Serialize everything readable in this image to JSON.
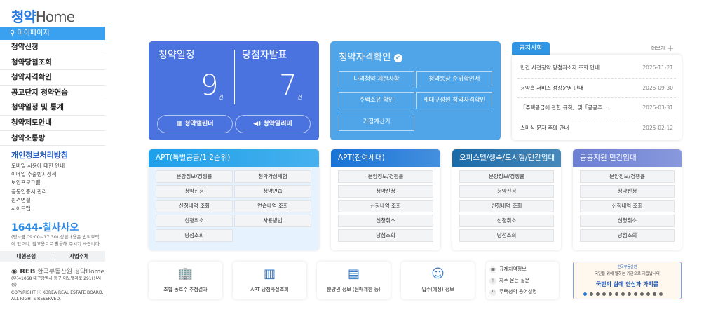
{
  "sidebar": {
    "logo_kr": "청약",
    "logo_en": "Home",
    "mypage": "마이페이지",
    "menu": [
      "청약신청",
      "청약당첨조회",
      "청약자격확인",
      "공고단지 청약연습",
      "청약일정 및 통계",
      "청약제도안내",
      "청약소통방"
    ],
    "policy": "개인정보처리방침",
    "links": [
      "모바일 사용에 대한 안내",
      "이메일 추출방지정책",
      "보안프로그램",
      "공동인증서 관리",
      "원격연결",
      "사이트맵"
    ],
    "phone": "1644-칠사사오",
    "phone_note": "(평~금 09:00~17:30) 상담내용은 법적효력이 없으니, 참고용으로 활용해 주시기 바랍니다.",
    "bank": "대행은행",
    "biz": "사업주체",
    "org": "한국부동산원",
    "org_logo": "REB",
    "org_app": "청약Home",
    "address": "(우)41068 대구광역시 동구 이노밸리로 291(신서동)",
    "copyright": "COPYRIGHT ⓒ KOREA REAL ESTATE BOARD, ALL RIGHTS RESERVED."
  },
  "schedule": {
    "title1": "청약일정",
    "count1": "9",
    "unit1": "건",
    "title2": "당첨자발표",
    "count2": "7",
    "unit2": "건",
    "btn1": "청약캘린더",
    "btn2": "청약알리미"
  },
  "eligibility": {
    "title": "청약자격확인",
    "buttons": [
      "나의청약 제한사항",
      "청약통장 순위확인서",
      "주택소유 확인",
      "세대구성원 청약자격확인",
      "가점계산기"
    ]
  },
  "notice": {
    "tab": "공지사항",
    "more": "더보기",
    "items": [
      {
        "title": "민간 사전청약 당첨취소자 조회 안내",
        "date": "2025-11-21"
      },
      {
        "title": "청약홈 서비스 정상운영 안내",
        "date": "2025-09-30"
      },
      {
        "title": "「주택공급에 관한 규칙」및「공공주…",
        "date": "2025-03-31"
      },
      {
        "title": "스미싱 문자 주의 안내",
        "date": "2025-02-12"
      }
    ]
  },
  "panels": [
    {
      "title": "APT(특별공급/1·2순위)",
      "color": "#1ea0ea",
      "buttons": [
        "분양정보/경쟁률",
        "청약가상체험",
        "청약신청",
        "청약연습",
        "신청내역 조회",
        "연습내역 조회",
        "신청취소",
        "사용방법",
        "당첨조회"
      ]
    },
    {
      "title": "APT(잔여세대)",
      "color": "#1673d6",
      "buttons": [
        "분양정보/경쟁률",
        "청약신청",
        "신청내역 조회",
        "신청취소",
        "당첨조회"
      ]
    },
    {
      "title": "오피스텔/생숙/도시형/민간임대",
      "color": "#1a6aa8",
      "buttons": [
        "분양정보/경쟁률",
        "청약신청",
        "신청내역 조회",
        "신청취소",
        "당첨조회"
      ]
    },
    {
      "title": "공공지원 민간임대",
      "color": "#6b7fd4",
      "buttons": [
        "분양정보/경쟁률",
        "청약신청",
        "신청내역 조회",
        "신청취소",
        "당첨조회"
      ]
    }
  ],
  "quick": [
    {
      "label": "조합 동호수 추첨결과",
      "icon": "hand-building-icon"
    },
    {
      "label": "APT 당첨사실조회",
      "icon": "apartment-icon"
    },
    {
      "label": "분양권 정보 (전매제한 등)",
      "icon": "hand-document-icon"
    },
    {
      "label": "입주(예정) 정보",
      "icon": "resident-icon"
    }
  ],
  "quick_list": [
    {
      "label": "규제지역정보",
      "glyph": "▦"
    },
    {
      "label": "자주 묻는 질문",
      "glyph": "!"
    },
    {
      "label": "주택청약 용어설명",
      "glyph": "가"
    }
  ],
  "banner": {
    "org": "한국부동산원",
    "sub": "국민을 위해 일하는 기관으로 거듭납니다",
    "main": "국민의 삶에 안심과 가치를"
  }
}
